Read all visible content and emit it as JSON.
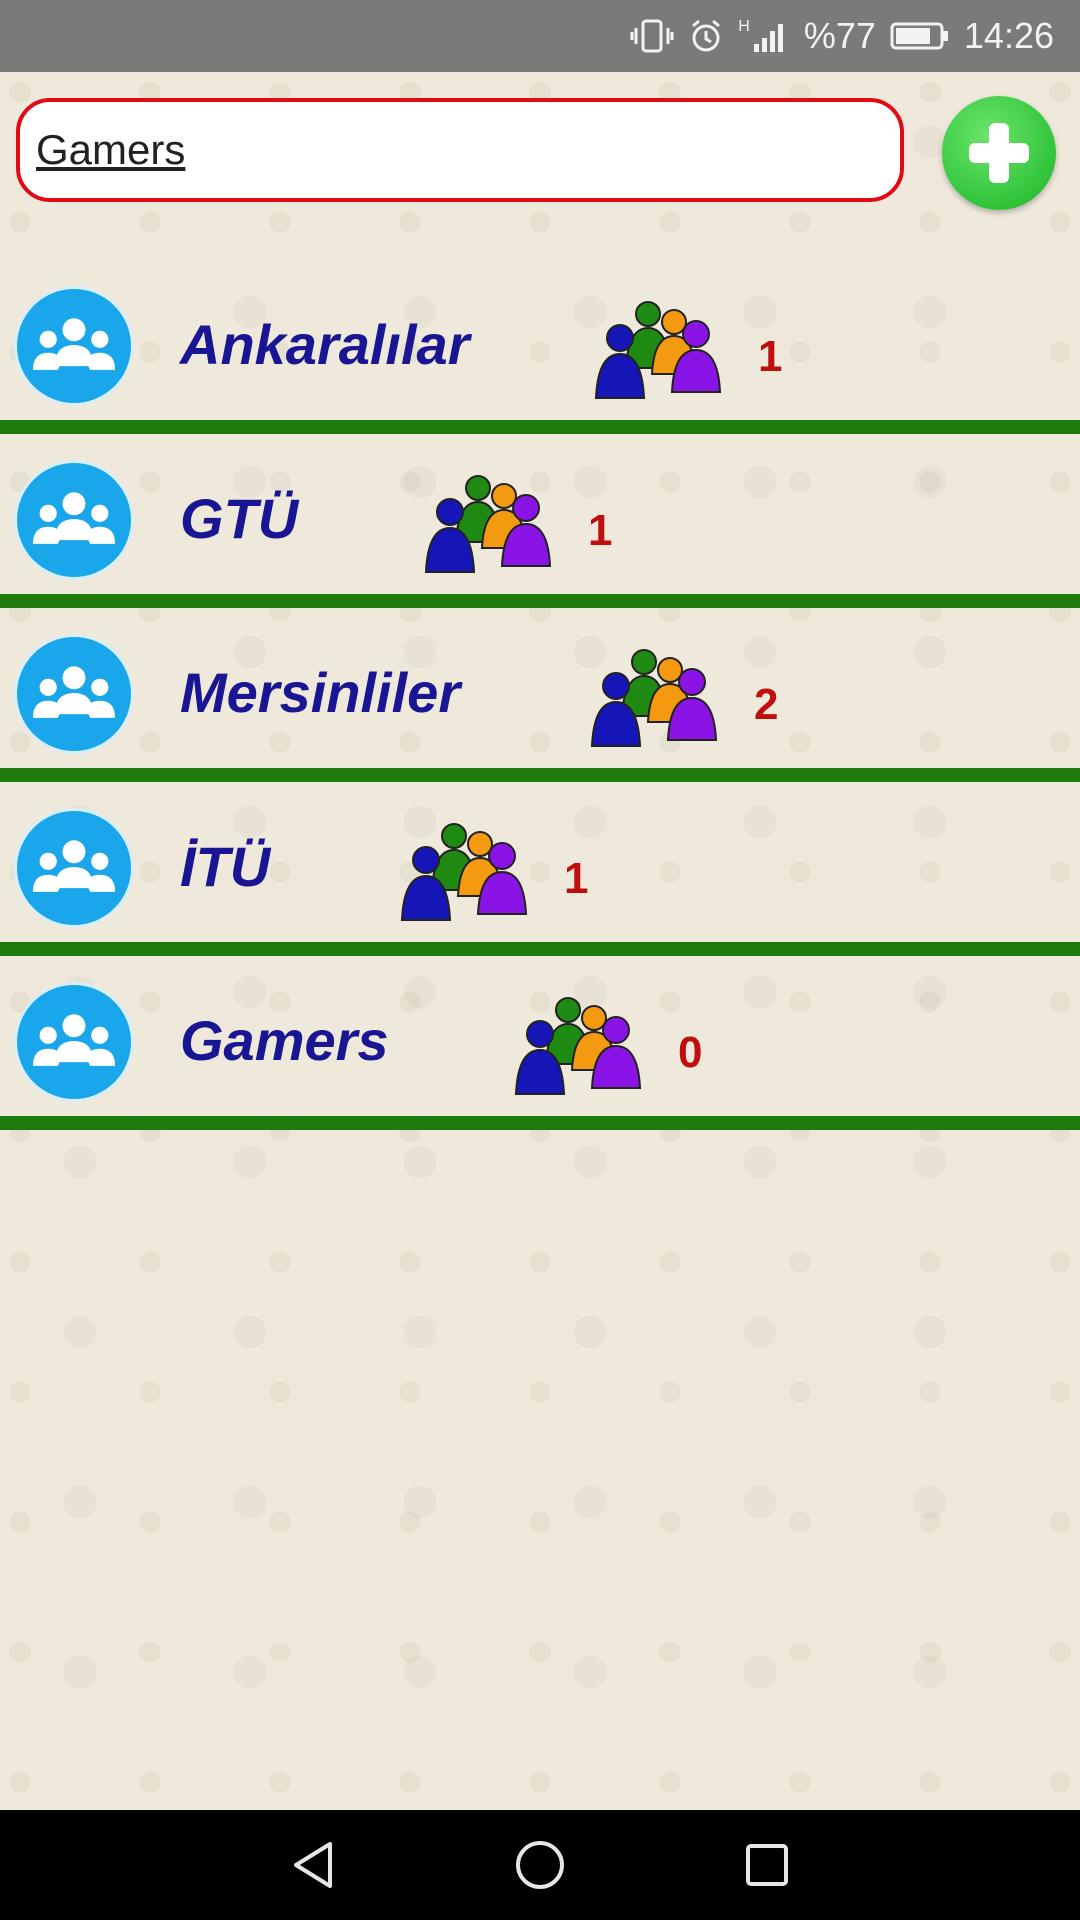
{
  "status_bar": {
    "battery_text": "%77",
    "time": "14:26",
    "network_label": "H",
    "icons": [
      "vibrate-icon",
      "alarm-icon",
      "signal-icon",
      "battery-icon"
    ]
  },
  "search": {
    "value": "Gamers",
    "add_icon": "plus-icon"
  },
  "groups": [
    {
      "name": "Ankaralılar",
      "count": "1"
    },
    {
      "name": "GTÜ",
      "count": "1"
    },
    {
      "name": "Mersinliler",
      "count": "2"
    },
    {
      "name": "İTÜ",
      "count": "1"
    },
    {
      "name": "Gamers",
      "count": "0"
    }
  ],
  "colors": {
    "accent_red": "#e20a17",
    "add_green": "#31c43a",
    "divider_green": "#1f7a0e",
    "group_name": "#1a1592",
    "count_red": "#c00e0e",
    "avatar_blue": "#1aa6ea"
  },
  "nav": {
    "icons": [
      "back-icon",
      "home-icon",
      "recents-icon"
    ]
  }
}
